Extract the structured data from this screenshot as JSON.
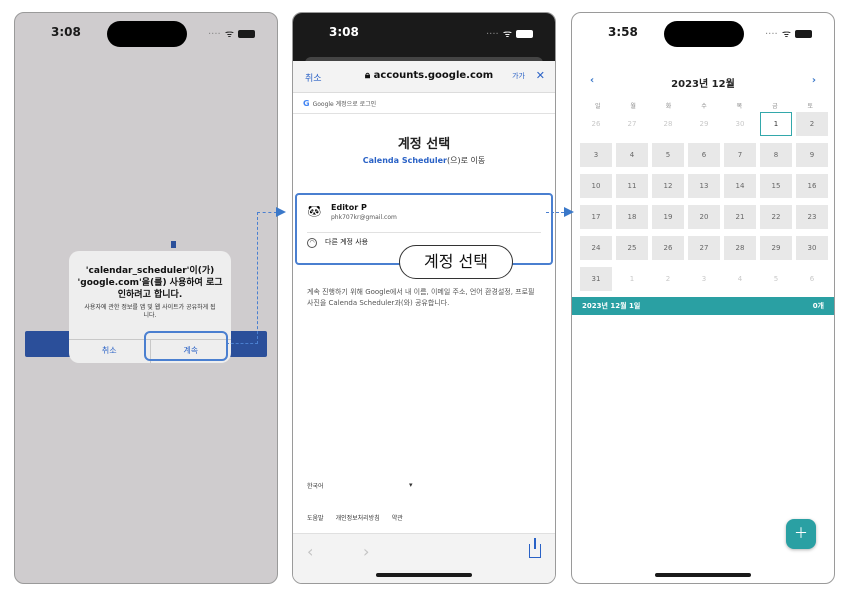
{
  "phone1": {
    "status": {
      "time": "3:08"
    },
    "alert": {
      "title": "'calendar_scheduler'이(가) 'google.com'을(를) 사용하여 로그인하려고 합니다.",
      "body": "사용자에 관한 정보를 앱 및 웹 사이트가 공유하게 됩니다.",
      "cancel_label": "취소",
      "continue_label": "계속"
    }
  },
  "phone2": {
    "status": {
      "time": "3:08"
    },
    "nav": {
      "cancel_label": "취소",
      "url": "accounts.google.com",
      "text_size_label": "가가",
      "close_label": "✕"
    },
    "google_bar": {
      "g_logo": "G",
      "text": "Google 계정으로 로그인"
    },
    "title": "계정 선택",
    "subtitle_app": "Calenda Scheduler",
    "subtitle_suffix": "(으)로 이동",
    "account": {
      "name": "Editor P",
      "email": "phk707kr@gmail.com"
    },
    "other_account_label": "다른 계정 사용",
    "callout": "계정 선택",
    "description": "계속 진행하기 위해 Google에서 내 이름, 이메일 주소, 언어 환경설정, 프로필 사진을 Calenda Scheduler과(와) 공유합니다.",
    "language": "한국어",
    "links": [
      "도움말",
      "개인정보처리방침",
      "약관"
    ]
  },
  "phone3": {
    "status": {
      "time": "3:58"
    },
    "month_title": "2023년 12월",
    "weekdays": [
      "일",
      "월",
      "화",
      "수",
      "목",
      "금",
      "토"
    ],
    "days": [
      [
        "26",
        "27",
        "28",
        "29",
        "30",
        "1",
        "2"
      ],
      [
        "3",
        "4",
        "5",
        "6",
        "7",
        "8",
        "9"
      ],
      [
        "10",
        "11",
        "12",
        "13",
        "14",
        "15",
        "16"
      ],
      [
        "17",
        "18",
        "19",
        "20",
        "21",
        "22",
        "23"
      ],
      [
        "24",
        "25",
        "26",
        "27",
        "28",
        "29",
        "30"
      ],
      [
        "31",
        "1",
        "2",
        "3",
        "4",
        "5",
        "6"
      ]
    ],
    "selected_date_label": "2023년 12월 1일",
    "event_count": "0개",
    "accent_color": "#2aa0a3"
  },
  "connector_color": "#3a78c9"
}
